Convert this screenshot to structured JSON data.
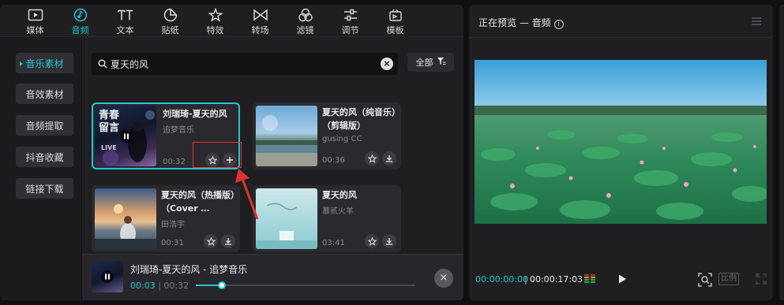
{
  "tabs": [
    {
      "label": "媒体",
      "icon": "media-icon"
    },
    {
      "label": "音频",
      "icon": "music-note-icon"
    },
    {
      "label": "文本",
      "icon": "text-icon"
    },
    {
      "label": "贴纸",
      "icon": "sticker-icon"
    },
    {
      "label": "特效",
      "icon": "effects-star-icon"
    },
    {
      "label": "转场",
      "icon": "transition-icon"
    },
    {
      "label": "滤镜",
      "icon": "filter-icon"
    },
    {
      "label": "调节",
      "icon": "adjust-sliders-icon"
    },
    {
      "label": "模板",
      "icon": "template-icon"
    }
  ],
  "active_tab": "音频",
  "sidebar": {
    "items": [
      "音乐素材",
      "音效素材",
      "音频提取",
      "抖音收藏",
      "链接下载"
    ],
    "active": "音乐素材"
  },
  "search": {
    "value": "夏天的风",
    "clear": "×"
  },
  "filter": {
    "label": "全部"
  },
  "cards": [
    {
      "title": "刘瑞琦-夏天的风",
      "artist": "追梦音乐",
      "duration": "00:32",
      "thumb_text_top": "青春\n留言",
      "thumb_text_bottom": "LIVE"
    },
    {
      "title": "夏天的风（纯音乐）（剪辑版）",
      "artist": "gusing CC",
      "duration": "00:36"
    },
    {
      "title": "夏天的风（热播版）（Cover …",
      "artist": "田浩宇",
      "duration": "00:31"
    },
    {
      "title": "夏天的风",
      "artist": "慕贰火羊",
      "duration": "03:41"
    }
  ],
  "player": {
    "title": "刘瑞琦-夏天的风 - 追梦音乐",
    "current": "00:03",
    "total": "00:32",
    "progress": 0.12,
    "close": "×"
  },
  "preview": {
    "title": "正在预览 — 音频",
    "info": "i",
    "time_current": "00:00:00:00",
    "time_separator": "|",
    "time_total": "00:00:17:03",
    "ratio_label": "比例"
  },
  "colors": {
    "accent": "#27c4d3",
    "highlight": "#e03131"
  }
}
